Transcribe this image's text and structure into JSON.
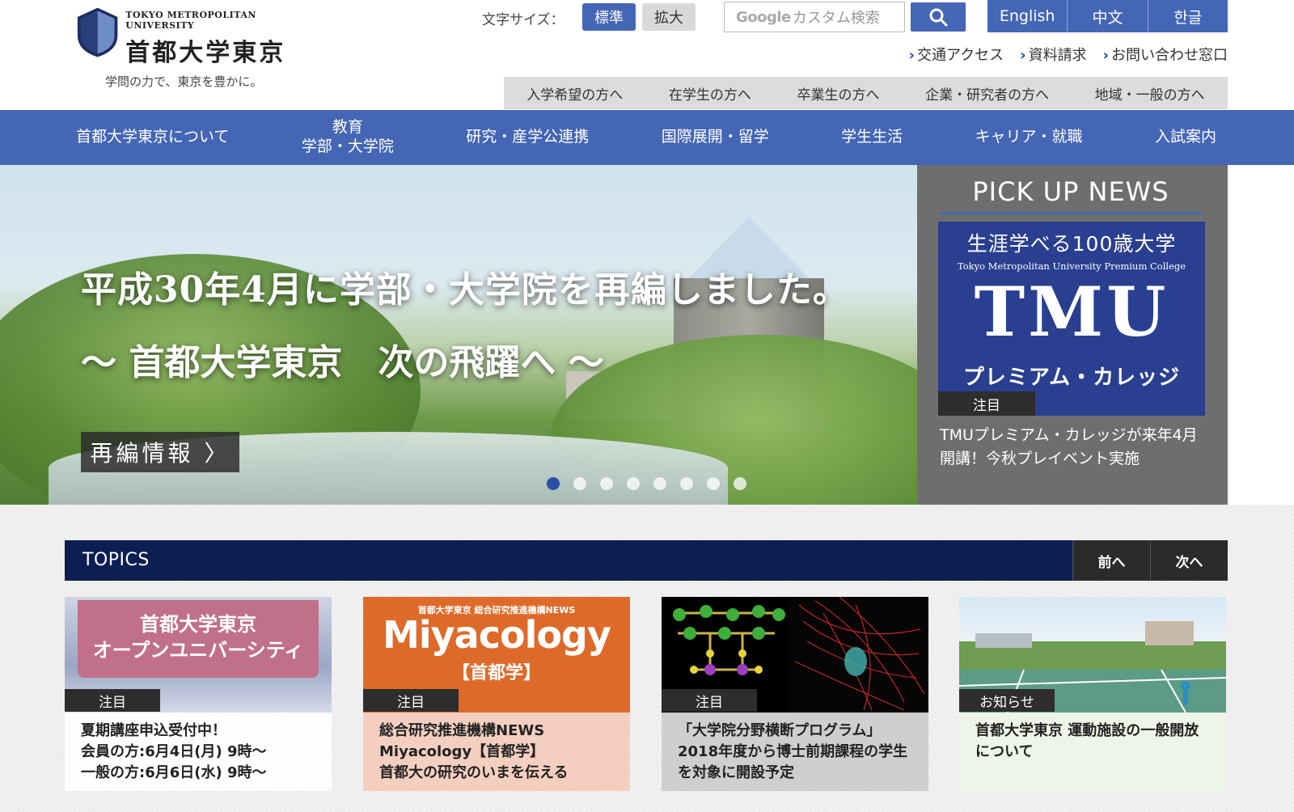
{
  "header": {
    "logo_en": "TOKYO METROPOLITAN UNIVERSITY",
    "logo_ja": "首都大学東京",
    "tagline": "学問の力で、東京を豊かに。",
    "font_size_label": "文字サイズ：",
    "font_size_standard": "標準",
    "font_size_large": "拡大",
    "search_google": "Google",
    "search_placeholder": "カスタム検索",
    "languages": [
      "English",
      "中文",
      "한글"
    ],
    "util_links": [
      "交通アクセス",
      "資料請求",
      "お問い合わせ窓口"
    ],
    "audience_nav": [
      "入学希望の方へ",
      "在学生の方へ",
      "卒業生の方へ",
      "企業・研究者の方へ",
      "地域・一般の方へ"
    ]
  },
  "main_nav": [
    {
      "label": "首都大学東京について"
    },
    {
      "label_line1": "教育",
      "label_line2": "学部・大学院"
    },
    {
      "label": "研究・産学公連携"
    },
    {
      "label": "国際展開・留学"
    },
    {
      "label": "学生生活"
    },
    {
      "label": "キャリア・就職"
    },
    {
      "label": "入試案内"
    }
  ],
  "hero": {
    "title": "平成30年4月に学部・大学院を再編しました。",
    "subtitle": "〜 首都大学東京　次の飛躍へ 〜",
    "button": "再編情報 〉",
    "dots": 8,
    "active_dot": 1
  },
  "pickup": {
    "title": "PICK UP NEWS",
    "card_line1": "生涯学べる100歳大学",
    "card_line2": "Tokyo Metropolitan University Premium College",
    "card_line3": "TMU",
    "card_line4": "プレミアム・カレッジ",
    "badge": "注目",
    "text": "TMUプレミアム・カレッジが来年4月開講！今秋プレイベント実施"
  },
  "topics": {
    "label": "TOPICS",
    "prev": "前へ",
    "next": "次へ",
    "cards": [
      {
        "image_text_1": "首都大学東京",
        "image_text_2": "オープンユニバーシティ",
        "badge": "注目",
        "text": "夏期講座申込受付中！\n会員の方:6月4日(月) 9時〜\n一般の方:6月6日(水) 9時〜"
      },
      {
        "image_text_1": "首都大学東京 総合研究推進機構NEWS",
        "image_text_2": "Miyacology",
        "image_text_3": "【首都学】",
        "badge": "注目",
        "text": "総合研究推進機構NEWS\nMiyacology【首都学】\n首都大の研究のいまを伝える"
      },
      {
        "badge": "注目",
        "text": "「大学院分野横断プログラム」2018年度から博士前期課程の学生を対象に開設予定"
      },
      {
        "badge": "お知らせ",
        "text": "首都大学東京 運動施設の一般開放について"
      }
    ]
  },
  "colors": {
    "brand_blue": "#4466b5",
    "topics_navy": "#0c1e52",
    "pickup_gray": "#6e6e6e"
  }
}
